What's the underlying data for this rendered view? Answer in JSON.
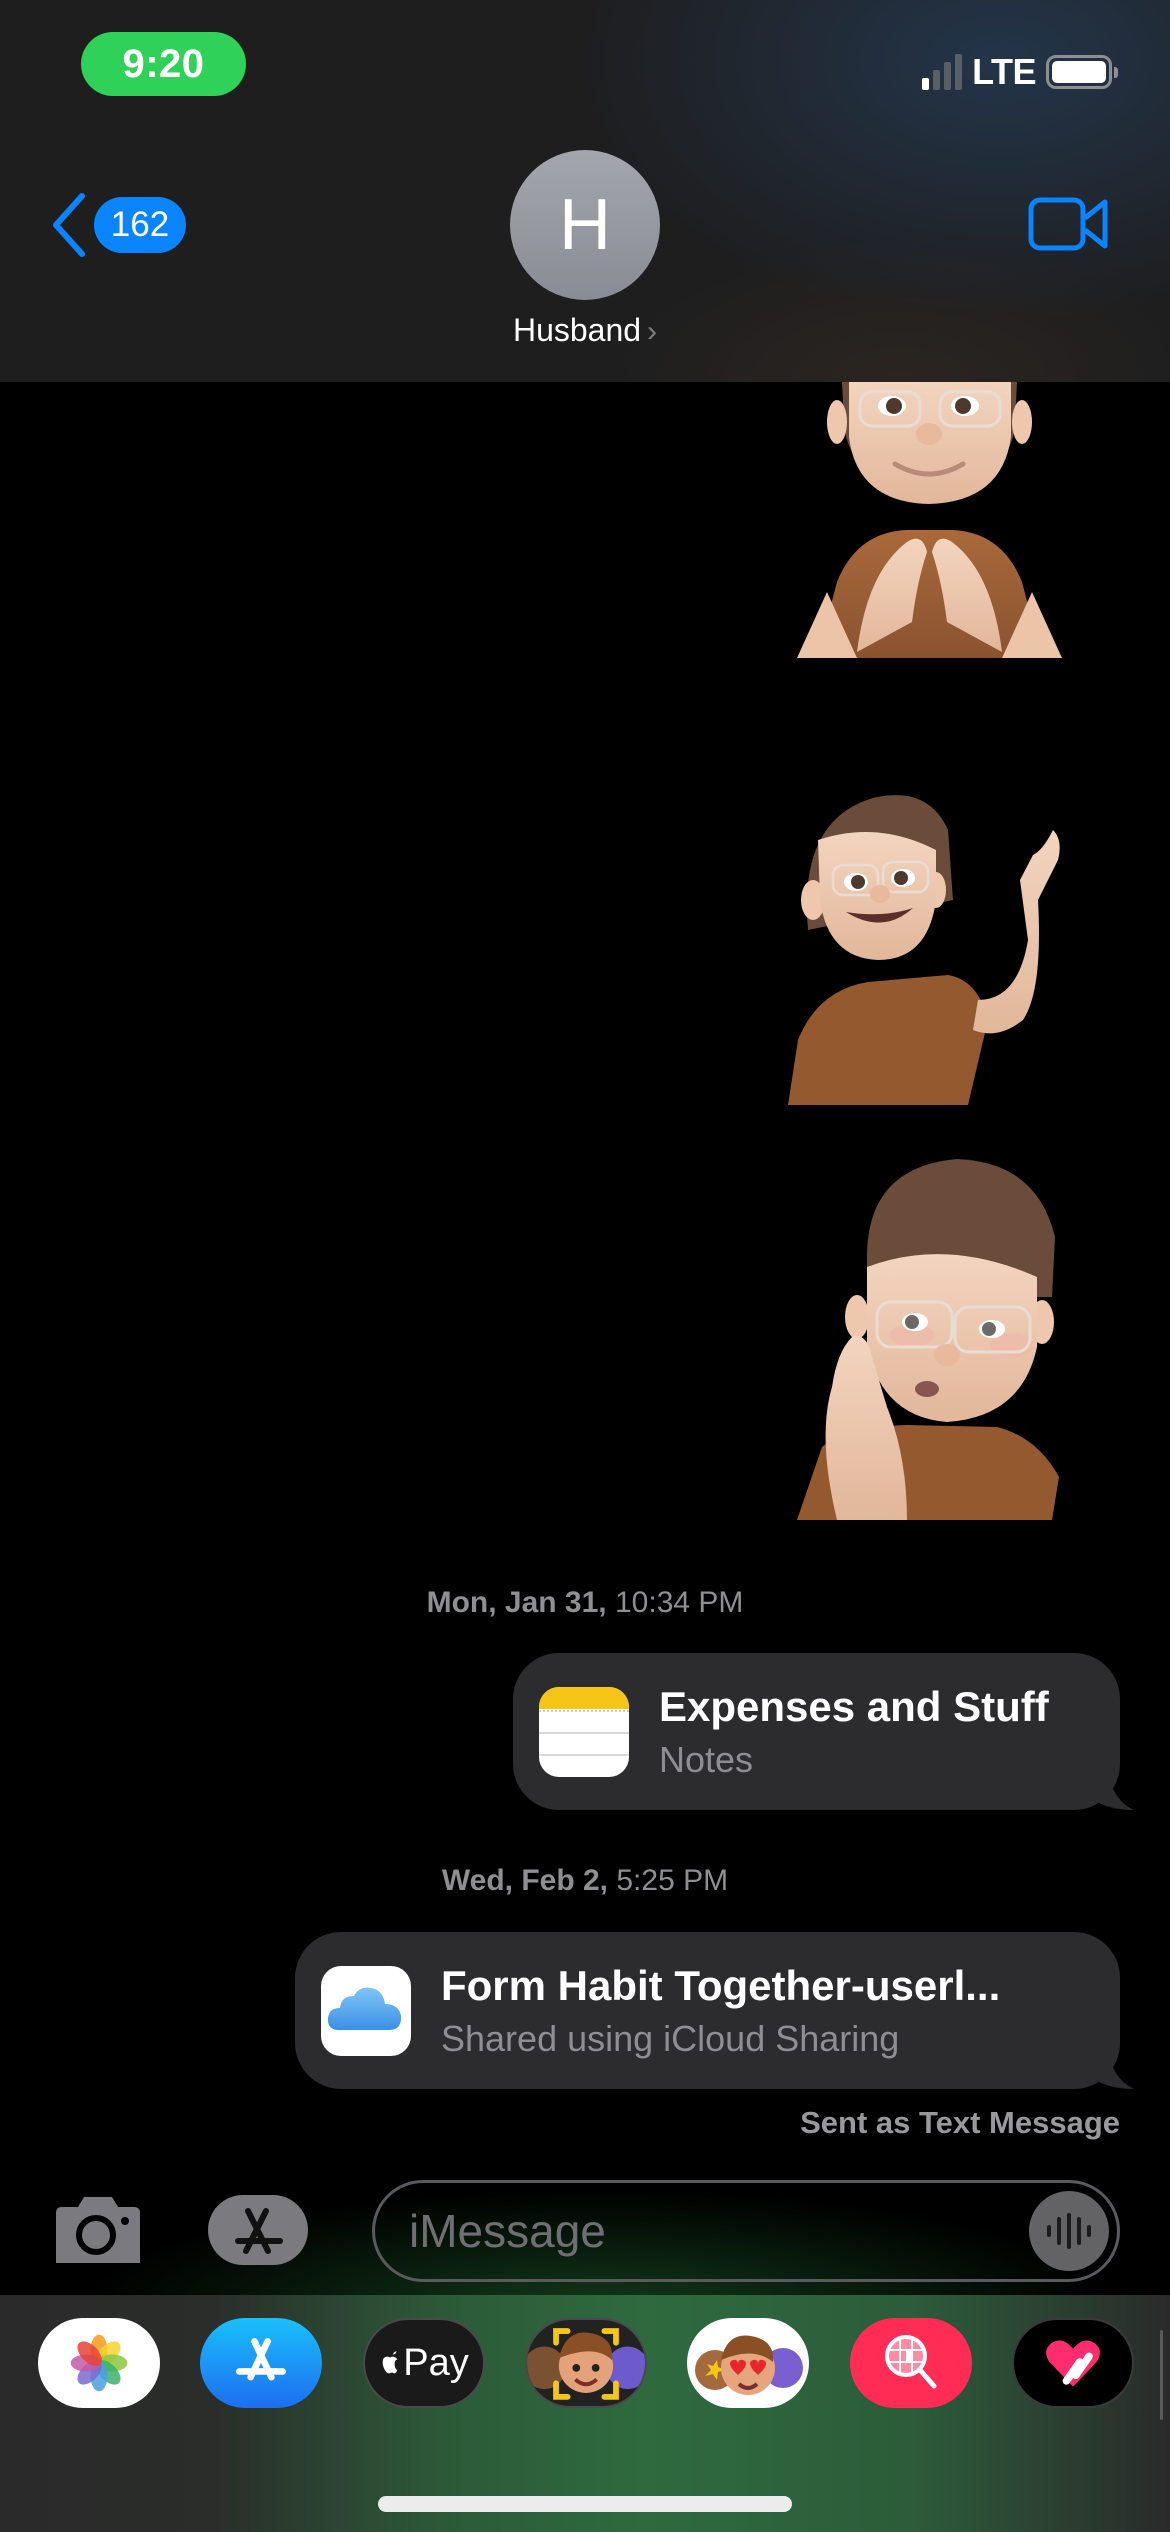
{
  "status_bar": {
    "time": "9:20",
    "network": "LTE",
    "signal_bars_active": 1,
    "signal_bars_total": 4,
    "battery_level": 1.0
  },
  "nav": {
    "back_count": "162",
    "contact_initial": "H",
    "contact_name": "Husband",
    "contact_chevron": "›",
    "video_icon": "video-camera-icon"
  },
  "messages": {
    "stickers": [
      {
        "description": "Memoji making heart with hands",
        "icon": "memoji-heart-hands-sticker"
      },
      {
        "description": "Memoji waving",
        "icon": "memoji-waving-sticker"
      },
      {
        "description": "Memoji hand on cheek",
        "icon": "memoji-cheek-sticker"
      }
    ],
    "timestamp_1": {
      "day": "Mon, Jan 31,",
      "time": "10:34 PM"
    },
    "note_bubble": {
      "title": "Expenses and Stuff",
      "subtitle": "Notes",
      "icon": "notes-app-icon"
    },
    "timestamp_2": {
      "day": "Wed, Feb 2,",
      "time": "5:25 PM"
    },
    "icloud_bubble": {
      "title": "Form Habit Together-userl...",
      "subtitle": "Shared using iCloud Sharing",
      "icon": "icloud-icon"
    },
    "delivery_status": "Sent as Text Message"
  },
  "composer": {
    "placeholder": "iMessage",
    "value": "",
    "camera_icon": "camera-icon",
    "apps_icon": "app-store-icon",
    "audio_icon": "waveform-icon"
  },
  "app_drawer": {
    "apps": [
      {
        "name": "Photos",
        "icon": "photos-icon"
      },
      {
        "name": "App Store",
        "icon": "app-store-icon"
      },
      {
        "name": "Apple Pay",
        "label": "Pay",
        "icon": "apple-pay-icon"
      },
      {
        "name": "Memoji",
        "icon": "memoji-icon"
      },
      {
        "name": "Memoji Stickers",
        "icon": "memoji-stickers-icon"
      },
      {
        "name": "Web Images",
        "icon": "globe-search-icon"
      },
      {
        "name": "Digital Touch",
        "icon": "heart-touch-icon"
      }
    ]
  },
  "colors": {
    "accent": "#0a84ff",
    "time_pill": "#30d158",
    "bubble": "#2c2c2e",
    "secondary_text": "#8e8e93"
  }
}
